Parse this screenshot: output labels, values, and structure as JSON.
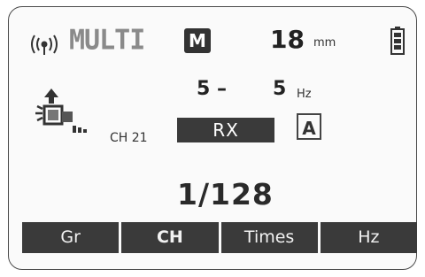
{
  "status": {
    "mode": "MULTI",
    "mode_badge": "M",
    "distance_value": "18",
    "distance_unit": "mm"
  },
  "frequency": {
    "from": "5 –",
    "to": "5",
    "unit": "Hz"
  },
  "channel": {
    "label": "CH 21",
    "state": "RX",
    "mode_indicator": "A"
  },
  "page_indicator": "1/128",
  "softkeys": [
    "Gr",
    "CH",
    "Times",
    "Hz"
  ],
  "icons": [
    "signal-icon",
    "m-box-icon",
    "battery-icon",
    "remote-device-icon"
  ]
}
